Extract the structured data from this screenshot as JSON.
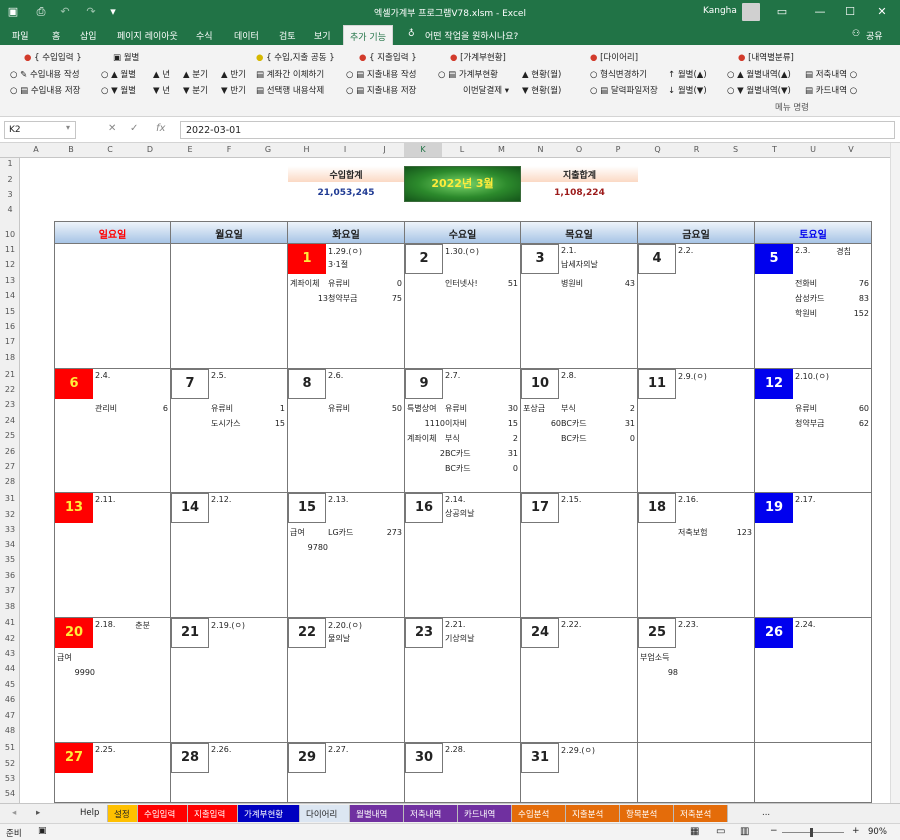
{
  "title_bar": {
    "title": "엑셀가계부 프로그램V78.xlsm - Excel",
    "user": "Kangha"
  },
  "menu": {
    "file": "파일",
    "home": "홈",
    "insert": "삽입",
    "layout": "페이지 레이아웃",
    "formula": "수식",
    "data": "데이터",
    "review": "검토",
    "view": "보기",
    "addin": "추가 기능",
    "tell": "어떤 작업을 원하시나요?",
    "share": "공유"
  },
  "ribbon": {
    "g1_title": "{ 수입입력 }",
    "g1_a": "수입내용 작성",
    "g1_b": "수입내용 저장",
    "g2_title": "월별",
    "g2_r1": [
      "월별",
      "년",
      "분기",
      "반기"
    ],
    "g2_r2": [
      "월별",
      "년",
      "분기",
      "반기"
    ],
    "g3_title": "{ 수입,지출 공동 }",
    "g3_a": "계좌간 이체하기",
    "g3_b": "선택행 내용삭제",
    "g4_title": "{ 지출입력 }",
    "g4_a": "지출내용 작성",
    "g4_b": "지출내용 저장",
    "g5_title": "[가계부현황]",
    "g5_a": "가계부현황",
    "g5_b": "이번달결제",
    "g5_c": "현황(월)",
    "g5_d": "현황(월)",
    "g6_title": "[다이어리]",
    "g6_a": "형식변경하기",
    "g6_b": "달력파일저장",
    "g7_title": "[내역별분류]",
    "g7_a": "월별",
    "g7_b": "월별",
    "g8_a": "월별내역",
    "g8_b": "월별내역",
    "g9_a": "저축내역",
    "g9_b": "카드내역",
    "menu_cmd": "메뉴 명령"
  },
  "formula_bar": {
    "cell": "K2",
    "value": "2022-03-01"
  },
  "columns": [
    "A",
    "B",
    "C",
    "D",
    "E",
    "F",
    "G",
    "H",
    "I",
    "J",
    "K",
    "L",
    "M",
    "N",
    "O",
    "P",
    "Q",
    "R",
    "S",
    "T",
    "U",
    "V"
  ],
  "rows": [
    "1",
    "2",
    "3",
    "4",
    "10",
    "11",
    "12",
    "13",
    "14",
    "15",
    "16",
    "17",
    "18",
    "21",
    "22",
    "23",
    "24",
    "25",
    "26",
    "27",
    "28",
    "31",
    "32",
    "33",
    "34",
    "35",
    "36",
    "37",
    "38",
    "41",
    "42",
    "43",
    "44",
    "45",
    "46",
    "47",
    "48",
    "51",
    "52",
    "53",
    "54"
  ],
  "summary": {
    "income_label": "수입합계",
    "income_value": "21,053,245",
    "month": "2022년 3월",
    "expense_label": "지출합계",
    "expense_value": "1,108,224"
  },
  "days": [
    "일요일",
    "월요일",
    "화요일",
    "수요일",
    "목요일",
    "금요일",
    "토요일"
  ],
  "weeks": [
    [
      {
        "d": "",
        "n": "",
        "t": "",
        "e": []
      },
      {
        "d": "",
        "n": "",
        "t": "",
        "e": []
      },
      {
        "d": "1",
        "red": true,
        "n": "1.29.(ㅇ)",
        "t": "3·1절",
        "e": [
          [
            "계좌이체",
            "유류비",
            "0"
          ],
          [
            "13",
            "청약부금",
            "75"
          ]
        ]
      },
      {
        "d": "2",
        "n": "1.30.(ㅇ)",
        "t": "",
        "e": [
          [
            "",
            "인터넷사!",
            "51"
          ]
        ]
      },
      {
        "d": "3",
        "n": "2.1.",
        "t": "납세자의날",
        "e": [
          [
            "",
            "병원비",
            "43"
          ]
        ]
      },
      {
        "d": "4",
        "n": "2.2.",
        "t": "",
        "e": []
      },
      {
        "d": "5",
        "blue": true,
        "n": "2.3.",
        "t": "",
        "sideTag": "경칩",
        "e": [
          [
            "",
            "전화비",
            "76"
          ],
          [
            "",
            "삼성카드",
            "83"
          ],
          [
            "",
            "학원비",
            "152"
          ]
        ]
      }
    ],
    [
      {
        "d": "6",
        "red": true,
        "n": "2.4.",
        "t": "",
        "e": [
          [
            "",
            "관리비",
            "6"
          ]
        ]
      },
      {
        "d": "7",
        "n": "2.5.",
        "t": "",
        "e": [
          [
            "",
            "유류비",
            "1"
          ],
          [
            "",
            "도시가스",
            "15"
          ]
        ]
      },
      {
        "d": "8",
        "n": "2.6.",
        "t": "",
        "e": [
          [
            "",
            "유류비",
            "50"
          ]
        ]
      },
      {
        "d": "9",
        "n": "2.7.",
        "t": "",
        "e": [
          [
            "특별상여",
            "유류비",
            "30"
          ],
          [
            "1110",
            "이자비",
            "15"
          ],
          [
            "계좌이체",
            "부식",
            "2"
          ],
          [
            "2",
            "BC카드",
            "31"
          ],
          [
            "",
            "BC카드",
            "0"
          ]
        ]
      },
      {
        "d": "10",
        "n": "2.8.",
        "t": "",
        "e": [
          [
            "포상금",
            "부식",
            "2"
          ],
          [
            "60",
            "BC카드",
            "31"
          ],
          [
            "",
            "BC카드",
            "0"
          ]
        ]
      },
      {
        "d": "11",
        "n": "2.9.(ㅇ)",
        "t": "",
        "e": []
      },
      {
        "d": "12",
        "blue": true,
        "n": "2.10.(ㅇ)",
        "t": "",
        "e": [
          [
            "",
            "유류비",
            "60"
          ],
          [
            "",
            "청약부금",
            "62"
          ]
        ]
      }
    ],
    [
      {
        "d": "13",
        "red": true,
        "n": "2.11.",
        "t": "",
        "e": []
      },
      {
        "d": "14",
        "n": "2.12.",
        "t": "",
        "e": []
      },
      {
        "d": "15",
        "n": "2.13.",
        "t": "",
        "e": [
          [
            "급여",
            "LG카드",
            "273"
          ],
          [
            "9780",
            "",
            ""
          ]
        ]
      },
      {
        "d": "16",
        "n": "2.14.",
        "t": "상공의날",
        "e": []
      },
      {
        "d": "17",
        "n": "2.15.",
        "t": "",
        "e": []
      },
      {
        "d": "18",
        "n": "2.16.",
        "t": "",
        "e": [
          [
            "",
            "저축보험",
            "123"
          ]
        ]
      },
      {
        "d": "19",
        "blue": true,
        "n": "2.17.",
        "t": "",
        "e": []
      }
    ],
    [
      {
        "d": "20",
        "red": true,
        "n": "2.18.",
        "t": "",
        "sideTag": "춘분",
        "e": [
          [
            "급여",
            "",
            ""
          ],
          [
            "9990",
            "",
            ""
          ]
        ]
      },
      {
        "d": "21",
        "n": "2.19.(ㅇ)",
        "t": "",
        "e": []
      },
      {
        "d": "22",
        "n": "2.20.(ㅇ)",
        "t": "물의날",
        "e": []
      },
      {
        "d": "23",
        "n": "2.21.",
        "t": "기상의날",
        "e": []
      },
      {
        "d": "24",
        "n": "2.22.",
        "t": "",
        "e": []
      },
      {
        "d": "25",
        "n": "2.23.",
        "t": "",
        "e": [
          [
            "부업소득",
            "",
            ""
          ],
          [
            "98",
            "",
            ""
          ]
        ]
      },
      {
        "d": "26",
        "blue": true,
        "n": "2.24.",
        "t": "",
        "e": []
      }
    ],
    [
      {
        "d": "27",
        "red": true,
        "n": "2.25.",
        "t": "",
        "e": []
      },
      {
        "d": "28",
        "n": "2.26.",
        "t": "",
        "e": []
      },
      {
        "d": "29",
        "n": "2.27.",
        "t": "",
        "e": []
      },
      {
        "d": "30",
        "n": "2.28.",
        "t": "",
        "e": []
      },
      {
        "d": "31",
        "n": "2.29.(ㅇ)",
        "t": "",
        "e": []
      },
      {
        "d": "",
        "n": "",
        "t": "",
        "e": []
      },
      {
        "d": "",
        "n": "",
        "t": "",
        "e": []
      }
    ]
  ],
  "tabs": [
    {
      "label": "Help",
      "bg": "#f0f0f0",
      "fg": "#222"
    },
    {
      "label": "설정",
      "bg": "#ffc000",
      "fg": "#222"
    },
    {
      "label": "수입입력",
      "bg": "#ff0000",
      "fg": "#fff"
    },
    {
      "label": "지출입력",
      "bg": "#ff0000",
      "fg": "#fff"
    },
    {
      "label": "가계부현황",
      "bg": "#0000c0",
      "fg": "#fff"
    },
    {
      "label": "다이어리",
      "bg": "#dce6f2",
      "fg": "#222"
    },
    {
      "label": "월별내역",
      "bg": "#7030a0",
      "fg": "#fff"
    },
    {
      "label": "저축내역",
      "bg": "#7030a0",
      "fg": "#fff"
    },
    {
      "label": "카드내역",
      "bg": "#7030a0",
      "fg": "#fff"
    },
    {
      "label": "수입분석",
      "bg": "#e46c0a",
      "fg": "#fff"
    },
    {
      "label": "지출분석",
      "bg": "#e46c0a",
      "fg": "#fff"
    },
    {
      "label": "항목분석",
      "bg": "#e46c0a",
      "fg": "#fff"
    },
    {
      "label": "저축분석",
      "bg": "#e46c0a",
      "fg": "#fff"
    }
  ],
  "status": {
    "ready": "준비",
    "zoom": "90%"
  },
  "colors": {
    "excel_green": "#217346",
    "sunday": "#ff0000",
    "saturday": "#0000ee"
  }
}
